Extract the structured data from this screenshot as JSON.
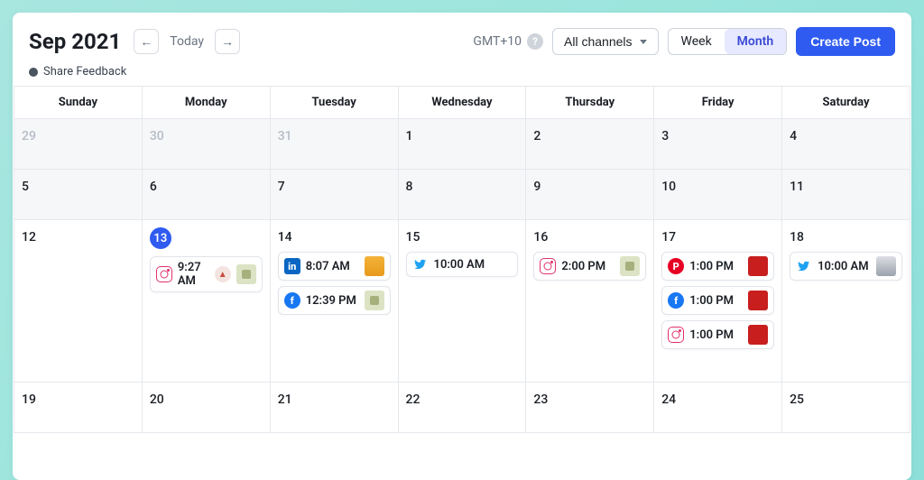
{
  "header": {
    "title": "Sep 2021",
    "today": "Today",
    "timezone": "GMT+10",
    "channels_label": "All channels",
    "view_week": "Week",
    "view_month": "Month",
    "create_post": "Create Post"
  },
  "feedback": {
    "label": "Share Feedback"
  },
  "days": [
    "Sunday",
    "Monday",
    "Tuesday",
    "Wednesday",
    "Thursday",
    "Friday",
    "Saturday"
  ],
  "grid": [
    [
      {
        "num": "29",
        "dim": true
      },
      {
        "num": "30",
        "dim": true
      },
      {
        "num": "31",
        "dim": true
      },
      {
        "num": "1"
      },
      {
        "num": "2"
      },
      {
        "num": "3"
      },
      {
        "num": "4"
      }
    ],
    [
      {
        "num": "5"
      },
      {
        "num": "6"
      },
      {
        "num": "7"
      },
      {
        "num": "8"
      },
      {
        "num": "9"
      },
      {
        "num": "10"
      },
      {
        "num": "11"
      }
    ],
    [
      {
        "num": "12"
      },
      {
        "num": "13",
        "today": true
      },
      {
        "num": "14"
      },
      {
        "num": "15"
      },
      {
        "num": "16"
      },
      {
        "num": "17"
      },
      {
        "num": "18"
      }
    ],
    [
      {
        "num": "19"
      },
      {
        "num": "20"
      },
      {
        "num": "21"
      },
      {
        "num": "22"
      },
      {
        "num": "23"
      },
      {
        "num": "24"
      },
      {
        "num": "25"
      }
    ]
  ],
  "posts": {
    "r2c1": [
      {
        "net": "ig",
        "time": "9:27 AM",
        "status": true,
        "thumb": "olive"
      }
    ],
    "r2c2": [
      {
        "net": "li",
        "time": "8:07 AM",
        "thumb": "gold"
      },
      {
        "net": "fb",
        "time": "12:39 PM",
        "thumb": "olive"
      }
    ],
    "r2c3": [
      {
        "net": "tw",
        "time": "10:00 AM"
      }
    ],
    "r2c4": [
      {
        "net": "ig",
        "time": "2:00 PM",
        "thumb": "olive"
      }
    ],
    "r2c5": [
      {
        "net": "pt",
        "time": "1:00 PM",
        "thumb": "red"
      },
      {
        "net": "fb",
        "time": "1:00 PM",
        "thumb": "red"
      },
      {
        "net": "ig",
        "time": "1:00 PM",
        "thumb": "red"
      }
    ],
    "r2c6": [
      {
        "net": "tw",
        "time": "10:00 AM",
        "thumb": "grey"
      }
    ]
  },
  "icons": {
    "li_letter": "in",
    "fb_letter": "f",
    "pt_letter": "P"
  }
}
